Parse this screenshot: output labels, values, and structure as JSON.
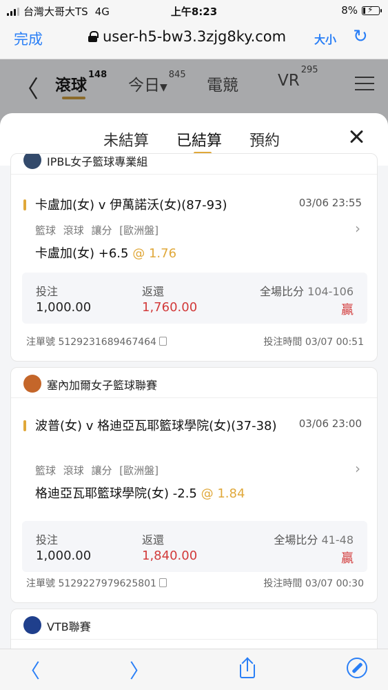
{
  "status": {
    "carrier": "台灣大哥大TS",
    "network": "4G",
    "time": "上午8:23",
    "battery": "8%"
  },
  "browser": {
    "done": "完成",
    "url": "user-h5-bw3.3zjg8ky.com",
    "textsize": "大小",
    "reload_icon": "reload-icon"
  },
  "header": {
    "tabs": [
      {
        "label": "滾球",
        "count": "148"
      },
      {
        "label": "今日",
        "count": "845"
      },
      {
        "label": "電競",
        "count": ""
      },
      {
        "label": "VR",
        "count": "295"
      }
    ]
  },
  "sheet": {
    "tabs": [
      "未結算",
      "已結算",
      "預約"
    ],
    "active_tab": "已結算"
  },
  "bets": [
    {
      "league": "IPBL女子籃球專業組",
      "match": "卡盧加(女) v 伊萬諾沃(女)(87-93)",
      "date": "03/06 23:55",
      "market": "籃球 滾球 讓分 [歐洲盤]",
      "selection": "卡盧加(女) +6.5",
      "odds": "@ 1.76",
      "stake_label": "投注",
      "stake": "1,000.00",
      "return_label": "返還",
      "return": "1,760.00",
      "score_label": "全場比分",
      "score": "104-106",
      "result": "贏",
      "ticket": "注單號 5129231689467464",
      "bet_time": "投注時間 03/07 00:51"
    },
    {
      "league": "塞內加爾女子籃球聯賽",
      "match": "波普(女) v 格迪亞瓦耶籃球學院(女)(37-38)",
      "date": "03/06 23:00",
      "market": "籃球 滾球 讓分 [歐洲盤]",
      "selection": "格迪亞瓦耶籃球學院(女) -2.5",
      "odds": "@ 1.84",
      "stake_label": "投注",
      "stake": "1,000.00",
      "return_label": "返還",
      "return": "1,840.00",
      "score_label": "全場比分",
      "score": "41-48",
      "result": "贏",
      "ticket": "注單號 5129227979625801",
      "bet_time": "投注時間 03/07 00:30"
    },
    {
      "league": "VTB聯賽"
    }
  ],
  "colors": {
    "accent": "#e0a83a",
    "win": "#d23a3a",
    "link": "#2a7ff6"
  }
}
